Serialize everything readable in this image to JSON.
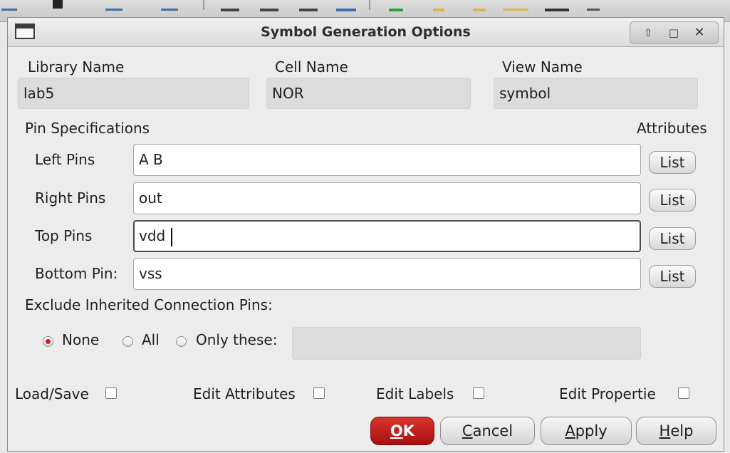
{
  "window": {
    "title": "Symbol Generation Options",
    "controls": [
      "up-arrow-icon",
      "maximize-icon",
      "close-icon"
    ]
  },
  "header": {
    "library_label": "Library Name",
    "library_value": "lab5",
    "cell_label": "Cell Name",
    "cell_value": "NOR",
    "view_label": "View Name",
    "view_value": "symbol"
  },
  "pins": {
    "section_label": "Pin Specifications",
    "attributes_label": "Attributes",
    "list_label": "List",
    "rows": [
      {
        "label": "Left Pins",
        "value": "A B"
      },
      {
        "label": "Right Pins",
        "value": "out"
      },
      {
        "label": "Top Pins",
        "value": "vdd"
      },
      {
        "label": "Bottom Pin:",
        "value": "vss"
      }
    ]
  },
  "exclude": {
    "label": "Exclude Inherited Connection Pins:",
    "options": [
      "None",
      "All",
      "Only these:"
    ],
    "selected": "None",
    "only_these_value": ""
  },
  "checks": [
    {
      "label": "Load/Save",
      "checked": false
    },
    {
      "label": "Edit Attributes",
      "checked": false
    },
    {
      "label": "Edit Labels",
      "checked": false
    },
    {
      "label": "Edit Propertie",
      "checked": false
    }
  ],
  "buttons": {
    "ok": {
      "mnemonic": "O",
      "rest": "K"
    },
    "cancel": {
      "mnemonic": "C",
      "rest": "ancel"
    },
    "apply": {
      "mnemonic": "A",
      "rest": "pply"
    },
    "help": {
      "mnemonic": "H",
      "rest": "elp"
    }
  },
  "colors": {
    "primary_button": "#c0201c",
    "radio_selected": "#cc1f1f"
  }
}
